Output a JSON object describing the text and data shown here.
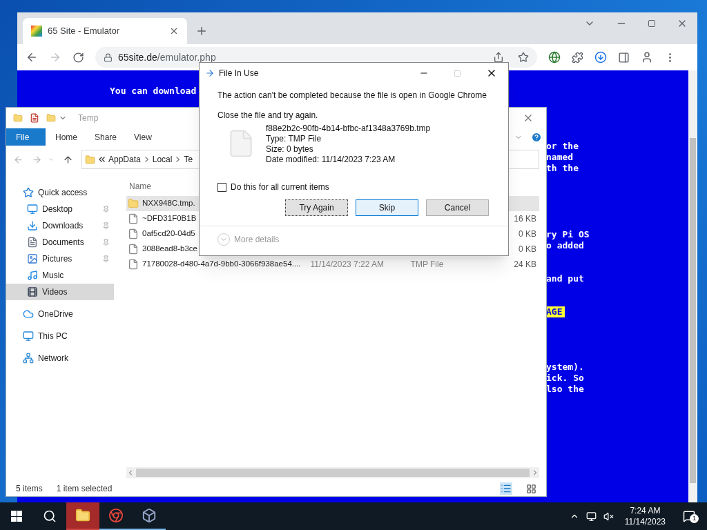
{
  "browser": {
    "tab": {
      "title": "65 Site - Emulator",
      "selected": true
    },
    "url": {
      "host": "65site.de",
      "path": "/emulator.php"
    },
    "screen": {
      "left_lines": [
        "You can download"
      ],
      "right_blocks": [
        {
          "lines": [
            "or the",
            "named",
            "th the"
          ],
          "highlighted": false
        },
        {
          "lines": [
            "ry Pi OS",
            "o added"
          ],
          "highlighted": false
        },
        {
          "lines": [
            "and put"
          ],
          "highlighted": false
        },
        {
          "lines": [
            "AGE"
          ],
          "highlighted": true
        },
        {
          "lines": [
            "ystem).",
            "ick. So",
            "lso the"
          ],
          "highlighted": false
        }
      ]
    }
  },
  "explorer": {
    "title": "Temp",
    "ribbon_tabs": [
      {
        "label": "File",
        "selected": true
      },
      {
        "label": "Home",
        "selected": false
      },
      {
        "label": "Share",
        "selected": false
      },
      {
        "label": "View",
        "selected": false
      }
    ],
    "breadcrumb": [
      "AppData",
      "Local",
      "Te"
    ],
    "nav": [
      {
        "label": "Quick access",
        "kind": "quick",
        "selected": false,
        "pinned": false
      },
      {
        "label": "Desktop",
        "kind": "desktop",
        "selected": false,
        "pinned": true
      },
      {
        "label": "Downloads",
        "kind": "downloads",
        "selected": false,
        "pinned": true
      },
      {
        "label": "Documents",
        "kind": "documents",
        "selected": false,
        "pinned": true
      },
      {
        "label": "Pictures",
        "kind": "pictures",
        "selected": false,
        "pinned": true
      },
      {
        "label": "Music",
        "kind": "music",
        "selected": false,
        "pinned": false
      },
      {
        "label": "Videos",
        "kind": "videos",
        "selected": true,
        "pinned": false
      },
      {
        "label": "OneDrive",
        "kind": "onedrive",
        "selected": false,
        "pinned": false
      },
      {
        "label": "This PC",
        "kind": "pc",
        "selected": false,
        "pinned": false
      },
      {
        "label": "Network",
        "kind": "network",
        "selected": false,
        "pinned": false
      }
    ],
    "column_name": "Name",
    "files": [
      {
        "name": "NXX948C.tmp.",
        "kind": "folder",
        "selected": true
      },
      {
        "name": "~DFD31F0B1B",
        "kind": "file",
        "selected": false,
        "size": "16 KB"
      },
      {
        "name": "0af5cd20-04d5",
        "kind": "file",
        "selected": false,
        "size": "0 KB"
      },
      {
        "name": "3088ead8-b3ce",
        "kind": "file",
        "selected": false,
        "size": "0 KB"
      },
      {
        "name": "71780028-d480-4a7d-9bb0-3066f938ae54....",
        "kind": "file",
        "selected": false,
        "date": "11/14/2023 7:22 AM",
        "type": "TMP File",
        "size": "24 KB"
      }
    ],
    "status": {
      "count": "5 items",
      "selection": "1 item selected"
    }
  },
  "dialog": {
    "title": "File In Use",
    "message": "The action can't be completed because the file is open in Google Chrome",
    "instruction": "Close the file and try again.",
    "file": {
      "name": "f88e2b2c-90fb-4b14-bfbc-af1348a3769b.tmp",
      "type": "Type: TMP File",
      "size": "Size: 0 bytes",
      "modified": "Date modified: 11/14/2023 7:23 AM"
    },
    "checkbox": {
      "label": "Do this for all current items",
      "checked": false
    },
    "buttons": [
      {
        "label": "Try Again",
        "kind": "focused"
      },
      {
        "label": "Skip",
        "kind": "hover"
      },
      {
        "label": "Cancel",
        "kind": "normal"
      }
    ],
    "more_details": "More details"
  },
  "taskbar": {
    "apps": [
      {
        "kind": "explorer",
        "active": true
      },
      {
        "kind": "chrome",
        "active": false
      },
      {
        "kind": "virtualbox",
        "active": false
      }
    ],
    "time": "7:24 AM",
    "date": "11/14/2023",
    "notifications": "1"
  }
}
